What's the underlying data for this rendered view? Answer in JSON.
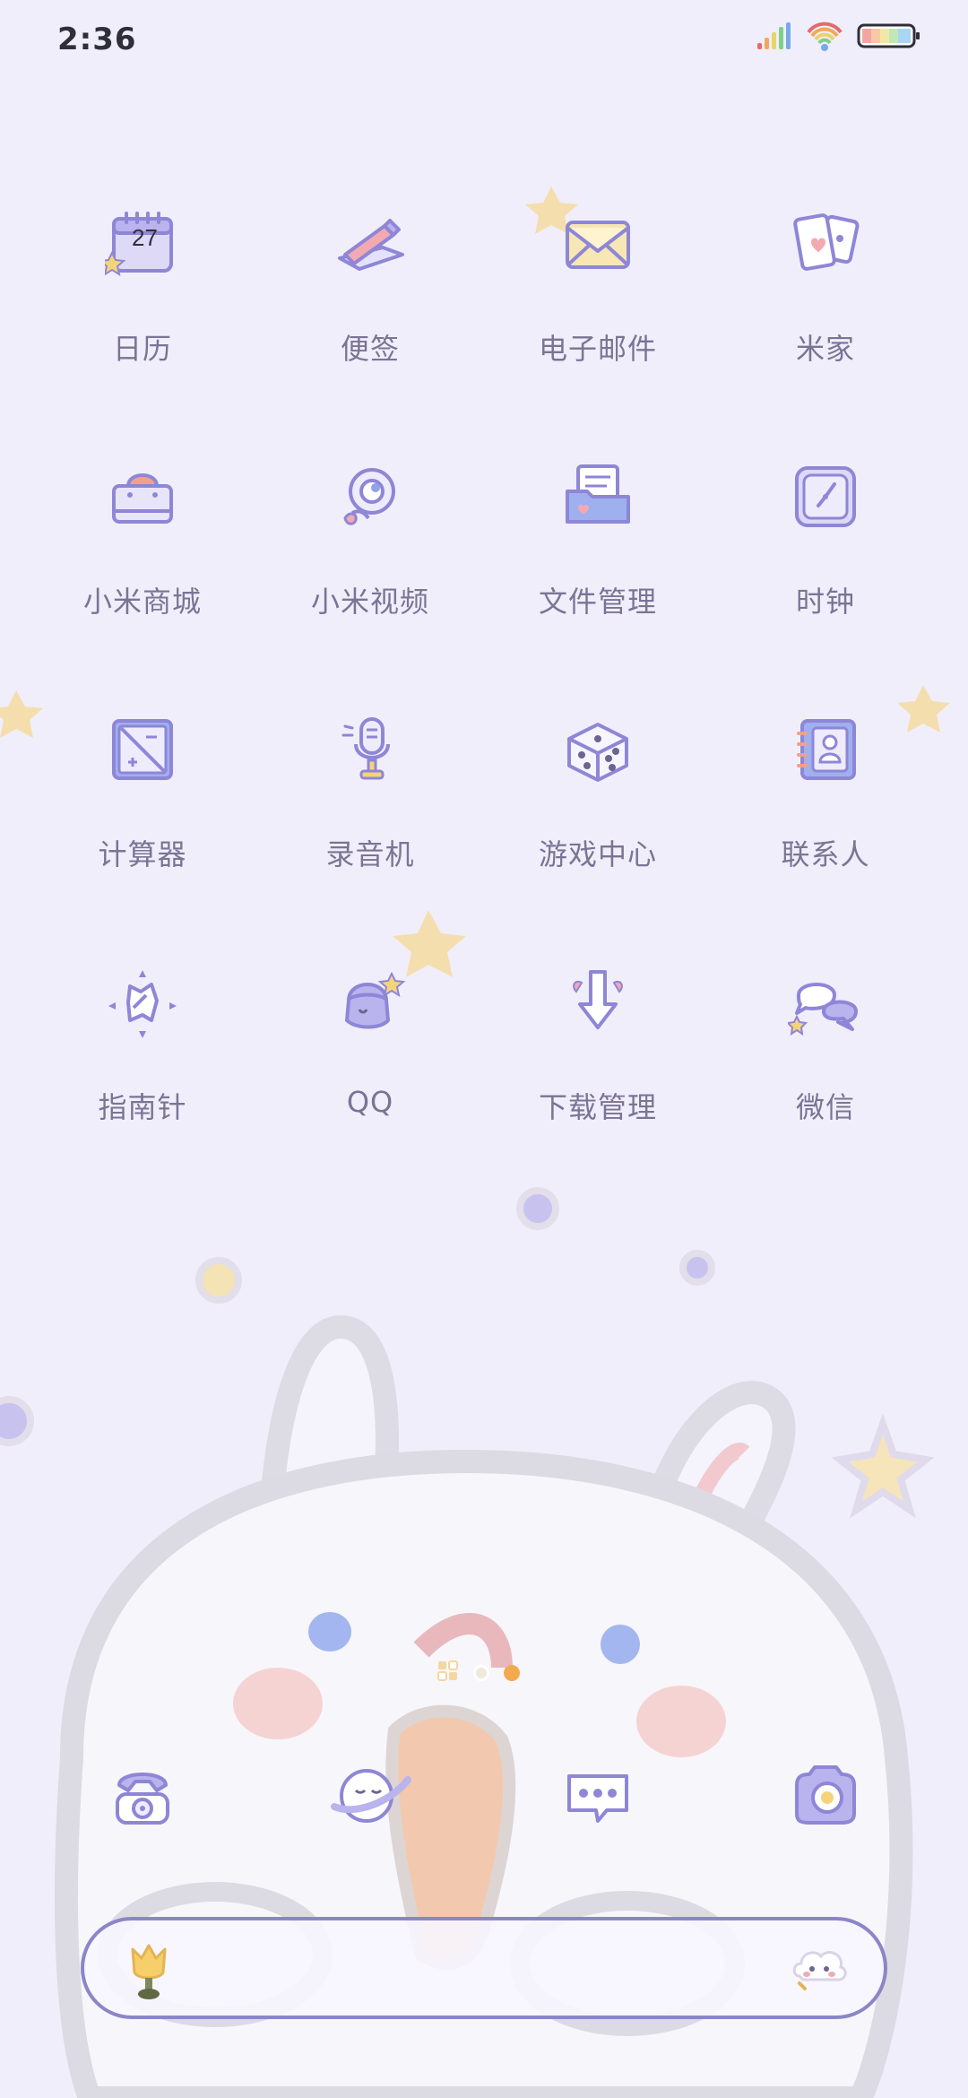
{
  "status_bar": {
    "time": "2:36",
    "icons": [
      "signal-icon",
      "wifi-icon",
      "battery-icon"
    ]
  },
  "apps": [
    {
      "name": "calendar",
      "label": "日历",
      "icon": "calendar-icon",
      "badge_text": "27"
    },
    {
      "name": "notes",
      "label": "便签",
      "icon": "pencil-note-icon"
    },
    {
      "name": "email",
      "label": "电子邮件",
      "icon": "envelope-icon"
    },
    {
      "name": "mijia",
      "label": "米家",
      "icon": "cards-icon"
    },
    {
      "name": "mi-store",
      "label": "小米商城",
      "icon": "shopping-bag-icon"
    },
    {
      "name": "mi-video",
      "label": "小米视频",
      "icon": "camera-lens-icon"
    },
    {
      "name": "file-manager",
      "label": "文件管理",
      "icon": "folder-icon"
    },
    {
      "name": "clock",
      "label": "时钟",
      "icon": "clock-icon"
    },
    {
      "name": "calculator",
      "label": "计算器",
      "icon": "calculator-icon"
    },
    {
      "name": "recorder",
      "label": "录音机",
      "icon": "microphone-icon"
    },
    {
      "name": "game-center",
      "label": "游戏中心",
      "icon": "dice-icon"
    },
    {
      "name": "contacts",
      "label": "联系人",
      "icon": "contact-book-icon"
    },
    {
      "name": "compass",
      "label": "指南针",
      "icon": "compass-icon"
    },
    {
      "name": "qq",
      "label": "QQ",
      "icon": "penguin-icon"
    },
    {
      "name": "download-manager",
      "label": "下载管理",
      "icon": "download-arrow-icon"
    },
    {
      "name": "wechat",
      "label": "微信",
      "icon": "chat-bubbles-icon"
    }
  ],
  "pager": {
    "pages": 2,
    "active": 2
  },
  "dock": [
    {
      "name": "phone",
      "icon": "telephone-icon"
    },
    {
      "name": "browser",
      "icon": "planet-icon"
    },
    {
      "name": "messages",
      "icon": "message-bubble-icon"
    },
    {
      "name": "camera",
      "icon": "camera-icon"
    }
  ],
  "search": {
    "left_icon": "tulip-icon",
    "right_icon": "cloud-assistant-icon"
  },
  "colors": {
    "background": "#f1eefb",
    "label": "#7a7495",
    "icon_purple": "#8e86d6",
    "accent_orange": "#f3aa4e",
    "search_border": "#8a86c7"
  }
}
